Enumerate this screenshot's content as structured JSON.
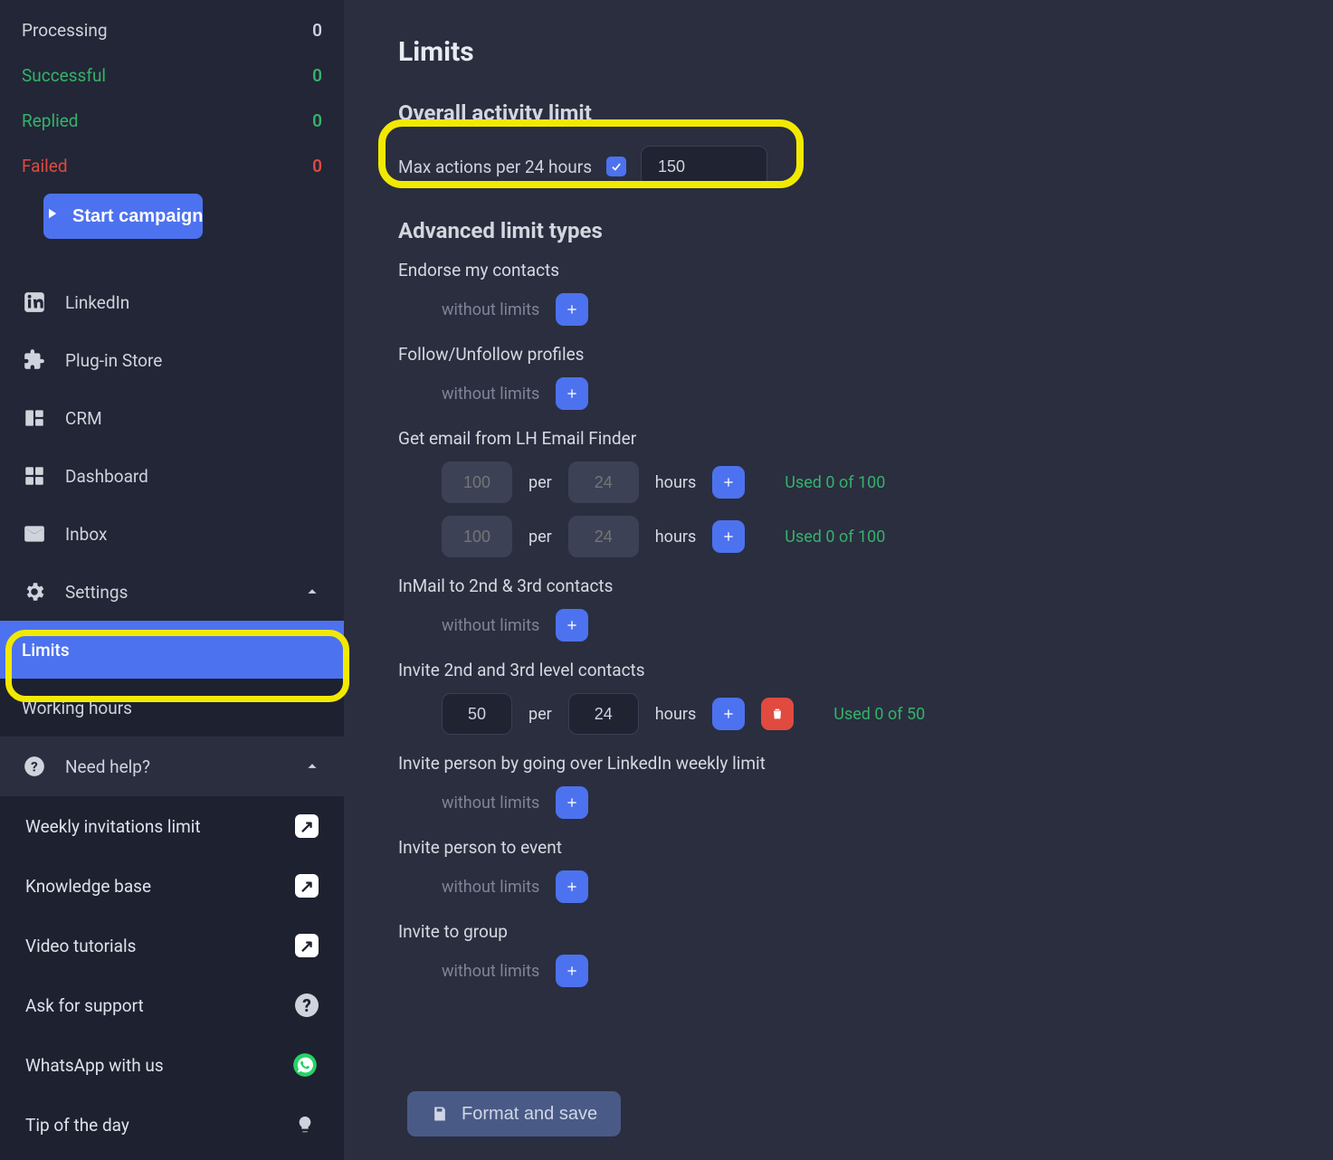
{
  "sidebar": {
    "stats": {
      "processing": {
        "label": "Processing",
        "value": "0"
      },
      "successful": {
        "label": "Successful",
        "value": "0"
      },
      "replied": {
        "label": "Replied",
        "value": "0"
      },
      "failed": {
        "label": "Failed",
        "value": "0"
      }
    },
    "start_label": "Start campaign",
    "nav": {
      "linkedin": "LinkedIn",
      "plugin": "Plug-in Store",
      "crm": "CRM",
      "dashboard": "Dashboard",
      "inbox": "Inbox",
      "settings": "Settings"
    },
    "settings_children": {
      "limits": "Limits",
      "working_hours": "Working hours"
    },
    "help": {
      "header": "Need help?",
      "weekly": "Weekly invitations limit",
      "kb": "Knowledge base",
      "video": "Video tutorials",
      "support": "Ask for support",
      "whatsapp": "WhatsApp with us",
      "tip": "Tip of the day"
    }
  },
  "page": {
    "title": "Limits",
    "overall_section": "Overall activity limit",
    "max_actions_label": "Max actions per 24 hours",
    "max_actions_checked": true,
    "max_actions_value": "150",
    "advanced_section": "Advanced limit types",
    "without_limits": "without limits",
    "per": "per",
    "hours": "hours",
    "save_label": "Format and save",
    "blocks": {
      "endorse": {
        "title": "Endorse my contacts"
      },
      "follow": {
        "title": "Follow/Unfollow profiles"
      },
      "emailf": {
        "title": "Get email from LH Email Finder",
        "rows": [
          {
            "amount_ph": "100",
            "per_ph": "24",
            "used": "Used 0 of 100"
          },
          {
            "amount_ph": "100",
            "per_ph": "24",
            "used": "Used 0 of 100"
          }
        ]
      },
      "inmail": {
        "title": "InMail to 2nd & 3rd contacts"
      },
      "invite23": {
        "title": "Invite 2nd and 3rd level contacts",
        "row": {
          "amount": "50",
          "per": "24",
          "used": "Used 0 of 50"
        }
      },
      "inviteweek": {
        "title": "Invite person by going over LinkedIn weekly limit"
      },
      "inviteevent": {
        "title": "Invite person to event"
      },
      "invitegroup": {
        "title": "Invite to group"
      }
    }
  }
}
